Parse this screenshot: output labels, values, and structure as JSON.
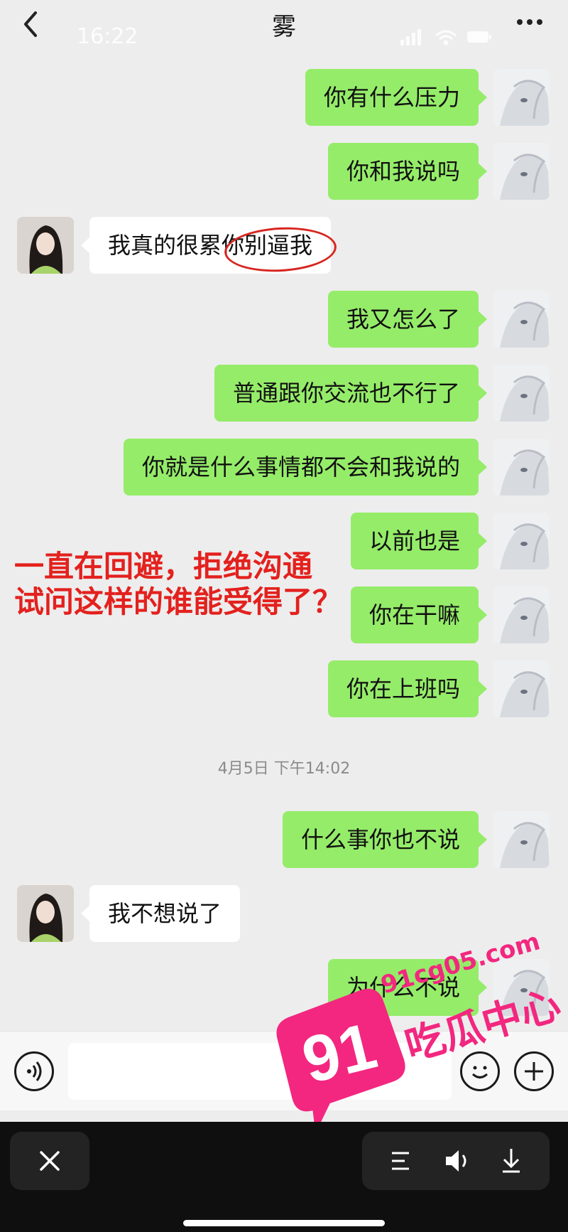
{
  "status_bar": {
    "time": "16:22"
  },
  "header": {
    "title": "雾"
  },
  "messages": [
    {
      "side": "me",
      "text": "你有什么压力"
    },
    {
      "side": "me",
      "text": "你和我说吗"
    },
    {
      "side": "her",
      "text": "我真的很累你别逼我"
    },
    {
      "side": "me",
      "text": "我又怎么了"
    },
    {
      "side": "me",
      "text": "普通跟你交流也不行了"
    },
    {
      "side": "me",
      "text": "你就是什么事情都不会和我说的"
    },
    {
      "side": "me",
      "text": "以前也是"
    },
    {
      "side": "me",
      "text": "你在干嘛"
    },
    {
      "side": "me",
      "text": "你在上班吗"
    },
    {
      "side": "me",
      "text": "什么事你也不说"
    },
    {
      "side": "her",
      "text": "我不想说了"
    },
    {
      "side": "me",
      "text": "为什么不说"
    }
  ],
  "timestamp": "4月5日 下午14:02",
  "annotation": {
    "line1": "一直在回避，拒绝沟通",
    "line2": "试问这样的谁能受得了？"
  },
  "watermark": {
    "number": "91",
    "url": "91cg05.com",
    "brand": "吃瓜中心"
  },
  "colors": {
    "my_bubble": "#95ec69",
    "her_bubble": "#ffffff",
    "annotation": "#e3211e",
    "watermark": "#f3277f"
  },
  "icons": {
    "back": "chevron-left-icon",
    "more": "more-dots-icon",
    "voice": "voice-icon",
    "emoji": "emoji-icon",
    "plus": "plus-icon",
    "close": "close-icon",
    "list": "list-icon",
    "speaker": "speaker-icon",
    "download": "download-icon"
  }
}
